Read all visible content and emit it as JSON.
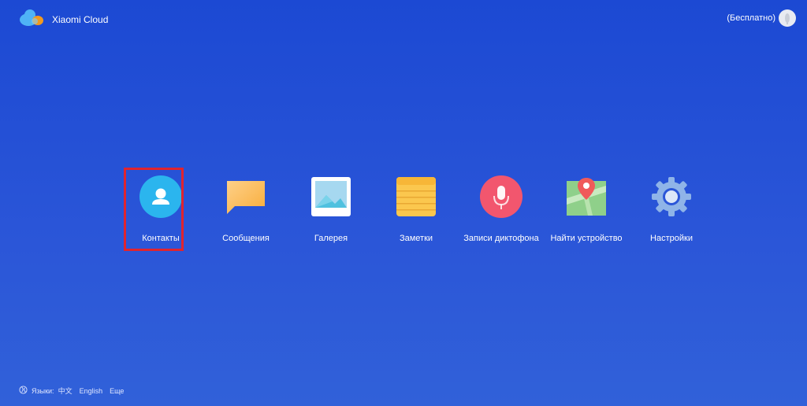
{
  "header": {
    "app_title": "Xiaomi Cloud",
    "plan_label": "(Бесплатно)"
  },
  "apps": [
    {
      "label": "Контакты",
      "icon": "contacts-icon",
      "selected": true
    },
    {
      "label": "Сообщения",
      "icon": "messages-icon"
    },
    {
      "label": "Галерея",
      "icon": "gallery-icon"
    },
    {
      "label": "Заметки",
      "icon": "notes-icon"
    },
    {
      "label": "Записи диктофона",
      "icon": "microphone-icon"
    },
    {
      "label": "Найти устройство",
      "icon": "find-device-map-icon"
    },
    {
      "label": "Настройки",
      "icon": "settings-gear-icon"
    }
  ],
  "footer": {
    "languages_label": "Языки:",
    "lang_zh": "中文",
    "lang_en": "English",
    "more": "Еще"
  },
  "colors": {
    "background": "#2550d6",
    "selection_border": "#e0242f",
    "contacts": "#2bb5ee",
    "messages": "#fbbf5f",
    "notes": "#fbc74e",
    "recorder": "#f2566e",
    "settings": "#8fb4e8"
  }
}
